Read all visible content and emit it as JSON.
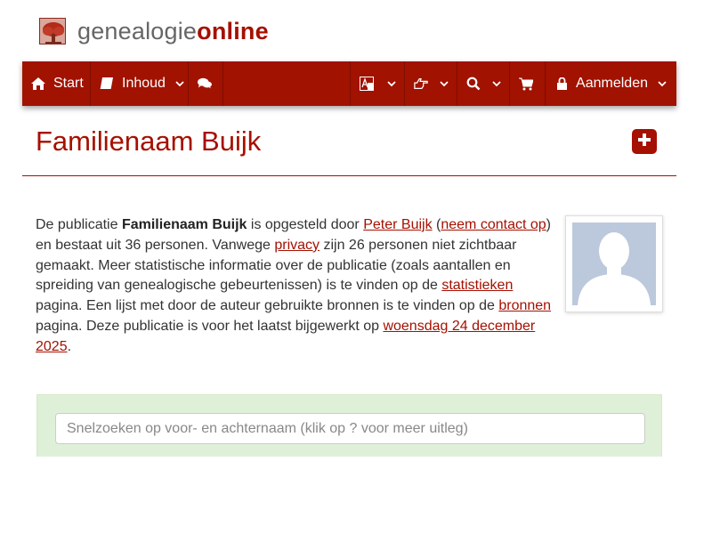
{
  "logo": {
    "part1": "genealogie",
    "part2": "online"
  },
  "nav": {
    "start": "Start",
    "inhoud": "Inhoud",
    "login": "Aanmelden"
  },
  "page": {
    "title": "Familienaam Buijk"
  },
  "description": {
    "t1": "De publicatie ",
    "name": "Familienaam Buijk",
    "t2": " is opgesteld door ",
    "author": "Peter Buijk",
    "t3": " (",
    "contact": "neem contact op",
    "t4": ") en bestaat uit 36 personen. Vanwege ",
    "privacy": "privacy",
    "t5": " zijn 26 personen niet zichtbaar gemaakt. Meer statistische informatie over de publicatie (zoals aantallen en spreiding van genealogische gebeurtenissen) is te vinden op de ",
    "stats": "statistieken",
    "t6": " pagina. Een lijst met door de auteur gebruikte bronnen is te vinden op de ",
    "sources": "bronnen",
    "t7": " pagina. Deze publicatie is voor het laatst bijgewerkt op ",
    "date": "woensdag 24 december 2025",
    "t8": "."
  },
  "search": {
    "placeholder": "Snelzoeken op voor- en achternaam (klik op ? voor meer uitleg)"
  },
  "icons": {
    "start": "home-icon",
    "inhoud": "book-icon",
    "forum": "comments-icon",
    "language": "language-icon",
    "help": "hand-point-icon",
    "search": "search-icon",
    "shop": "cart-icon",
    "login": "lock-icon",
    "add": "plus-square-icon"
  },
  "colors": {
    "brand": "#a11200",
    "panel": "#dff0d8"
  }
}
